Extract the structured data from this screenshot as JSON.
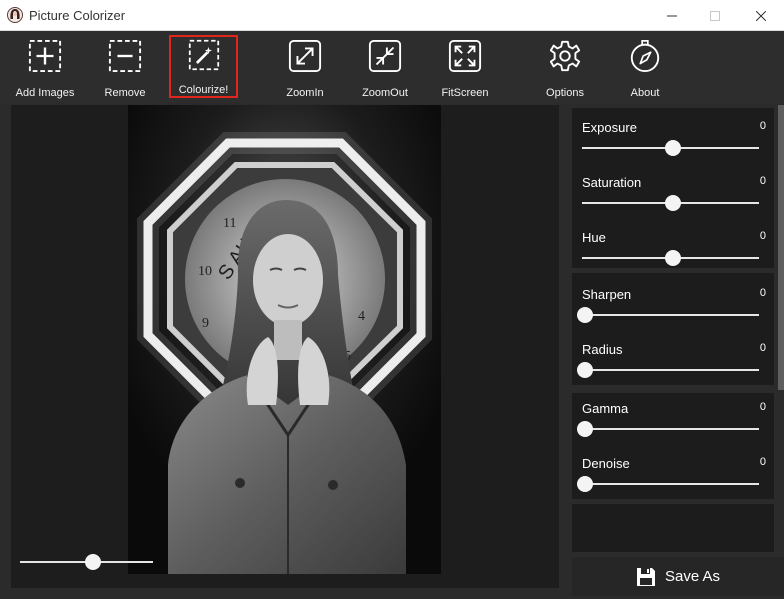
{
  "window": {
    "title": "Picture Colorizer"
  },
  "toolbar": {
    "items": [
      {
        "label": "Add Images",
        "icon": "add-images-icon"
      },
      {
        "label": "Remove",
        "icon": "remove-icon"
      },
      {
        "label": "Colourize!",
        "icon": "colourize-wand-icon",
        "active": true
      },
      {
        "label": "ZoomIn",
        "icon": "zoom-in-icon"
      },
      {
        "label": "ZoomOut",
        "icon": "zoom-out-icon"
      },
      {
        "label": "FitScreen",
        "icon": "fit-screen-icon"
      },
      {
        "label": "Options",
        "icon": "gear-icon"
      },
      {
        "label": "About",
        "icon": "compass-icon"
      }
    ]
  },
  "canvas": {
    "zoom_level_fraction": 0.55
  },
  "adjustments": {
    "exposure": {
      "label": "Exposure",
      "value": "0"
    },
    "saturation": {
      "label": "Saturation",
      "value": "0"
    },
    "hue": {
      "label": "Hue",
      "value": "0"
    },
    "sharpen": {
      "label": "Sharpen",
      "value": "0"
    },
    "radius": {
      "label": "Radius",
      "value": "0"
    },
    "gamma": {
      "label": "Gamma",
      "value": "0"
    },
    "denoise": {
      "label": "Denoise",
      "value": "0"
    }
  },
  "save": {
    "label": "Save As",
    "icon": "floppy-disk-icon"
  },
  "colors": {
    "active_outline": "#e0251b",
    "panel_bg": "#1c1c1c",
    "toolbar_bg": "#2d2d2d"
  }
}
